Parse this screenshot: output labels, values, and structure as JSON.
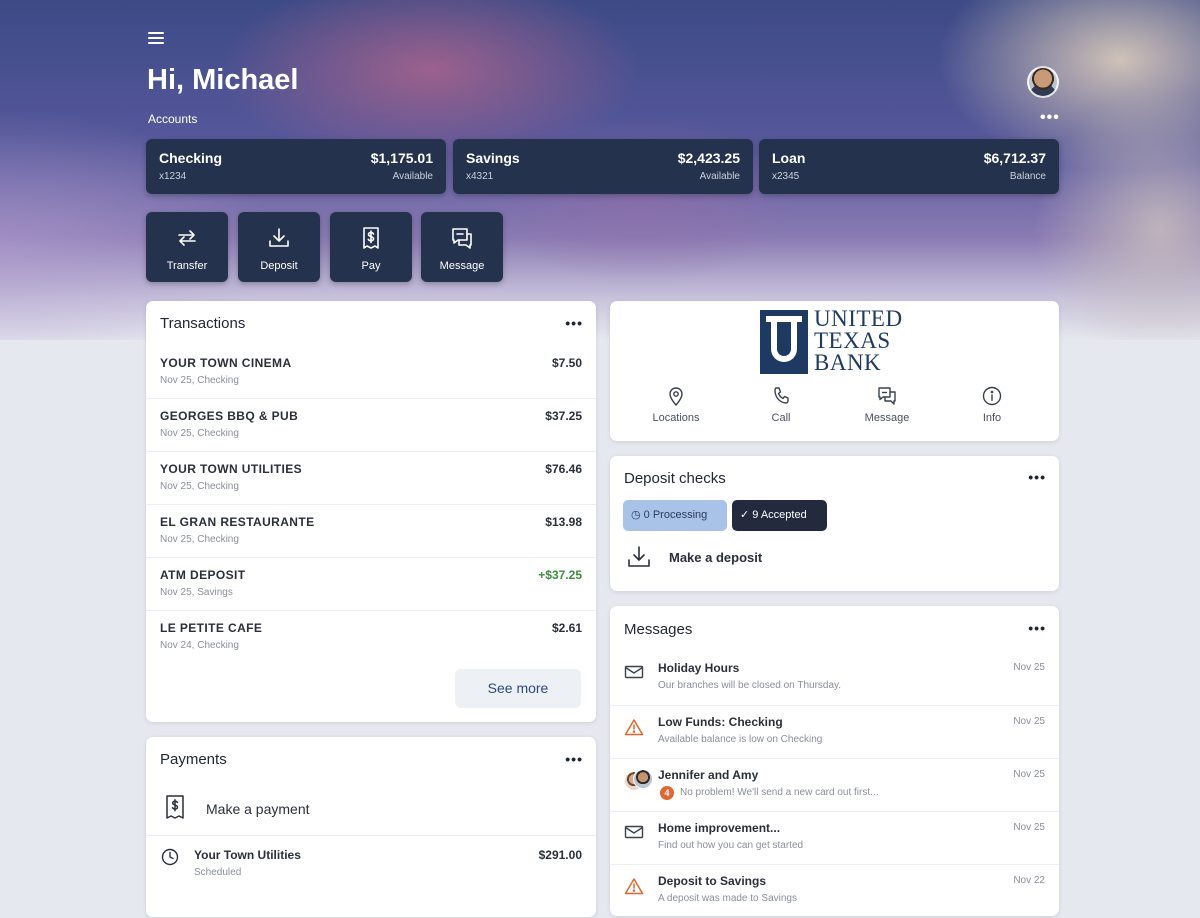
{
  "header": {
    "greeting": "Hi, Michael",
    "accounts_label": "Accounts"
  },
  "accounts": [
    {
      "name": "Checking",
      "number": "x1234",
      "amount": "$1,175.01",
      "sub": "Available"
    },
    {
      "name": "Savings",
      "number": "x4321",
      "amount": "$2,423.25",
      "sub": "Available"
    },
    {
      "name": "Loan",
      "number": "x2345",
      "amount": "$6,712.37",
      "sub": "Balance"
    }
  ],
  "quick_actions": [
    {
      "label": "Transfer",
      "icon": "transfer-icon"
    },
    {
      "label": "Deposit",
      "icon": "download-tray-icon"
    },
    {
      "label": "Pay",
      "icon": "bill-dollar-icon"
    },
    {
      "label": "Message",
      "icon": "chat-bubble-icon"
    }
  ],
  "transactions": {
    "title": "Transactions",
    "items": [
      {
        "name": "YOUR TOWN CINEMA",
        "meta": "Nov 25, Checking",
        "amount": "$7.50"
      },
      {
        "name": "GEORGES BBQ & PUB",
        "meta": "Nov 25, Checking",
        "amount": "$37.25"
      },
      {
        "name": "YOUR TOWN UTILITIES",
        "meta": "Nov 25, Checking",
        "amount": "$76.46"
      },
      {
        "name": "EL GRAN RESTAURANTE",
        "meta": "Nov 25, Checking",
        "amount": "$13.98"
      },
      {
        "name": "ATM DEPOSIT",
        "meta": "Nov 25, Savings",
        "amount": "+$37.25"
      },
      {
        "name": "LE PETITE CAFE",
        "meta": "Nov 24, Checking",
        "amount": "$2.61"
      }
    ],
    "see_more": "See more"
  },
  "payments": {
    "title": "Payments",
    "make_payment": "Make a payment",
    "items": [
      {
        "name": "Your Town Utilities",
        "status": "Scheduled",
        "amount": "$291.00"
      }
    ]
  },
  "bank": {
    "logo_line1": "UNITED",
    "logo_line2": "TEXAS",
    "logo_line3": "BANK",
    "actions": [
      {
        "label": "Locations",
        "icon": "map-pin-icon"
      },
      {
        "label": "Call",
        "icon": "phone-icon"
      },
      {
        "label": "Message",
        "icon": "chat-bubble-icon"
      },
      {
        "label": "Info",
        "icon": "info-icon"
      }
    ]
  },
  "deposit_checks": {
    "title": "Deposit checks",
    "processing": "0 Processing",
    "accepted": "9 Accepted",
    "make_deposit": "Make a deposit"
  },
  "messages": {
    "title": "Messages",
    "items": [
      {
        "title": "Holiday Hours",
        "snippet": "Our branches will be closed on Thursday.",
        "date": "Nov 25",
        "icon": "envelope-icon"
      },
      {
        "title": "Low Funds: Checking",
        "snippet": "Available balance is low on Checking",
        "date": "Nov 25",
        "icon": "warning-icon"
      },
      {
        "title": "Jennifer and Amy",
        "snippet": "No problem! We'll send a new card out first...",
        "date": "Nov 25",
        "icon": "group-avatar-icon",
        "badge": "4"
      },
      {
        "title": "Home improvement...",
        "snippet": "Find out how you can get started",
        "date": "Nov 25",
        "icon": "envelope-icon"
      },
      {
        "title": "Deposit to Savings",
        "snippet": "A deposit was made to Savings",
        "date": "Nov 22",
        "icon": "warning-icon"
      }
    ]
  },
  "colors": {
    "account_card": "#24324d",
    "credit_green": "#3e8e3a",
    "processing_chip": "#a9c2e8",
    "accepted_chip": "#232a3d",
    "warning_orange": "#e0672f",
    "bank_navy": "#1e3a63"
  }
}
